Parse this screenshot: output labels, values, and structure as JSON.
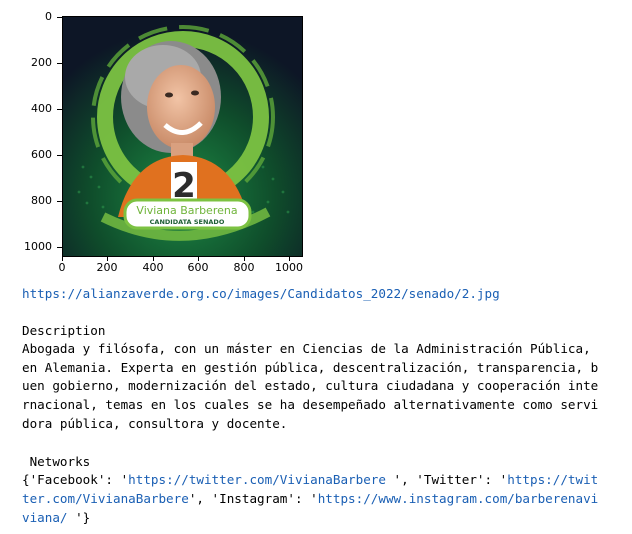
{
  "plot": {
    "yticks": [
      "0",
      "200",
      "400",
      "600",
      "800",
      "1000"
    ],
    "xticks": [
      "0",
      "200",
      "400",
      "600",
      "800",
      "1000"
    ],
    "image": {
      "name_line": "Viviana Barberena",
      "role_line": "CANDIDATA SENADO",
      "number": "2"
    }
  },
  "output": {
    "url": "https://alianzaverde.org.co/images/Candidatos_2022/senado/2.jpg",
    "description_label": "Description",
    "description_lines": [
      "Abogada y filósofa, con un máster en Ciencias de la Administración Pública,",
      "en Alemania. Experta en gestión pública, descentralización, transparencia, b",
      "uen gobierno, modernización del estado, cultura ciudadana y cooperación inte",
      "rnacional, temas en los cuales se ha desempeñado alternativamente como servi",
      "dora pública, consultora y docente."
    ],
    "networks_label": " Networks",
    "networks_lines": [
      {
        "pre": "{'Facebook': '",
        "link": "https://twitter.com/VivianaBarbere ",
        "post": "', 'Twitter': '",
        "link2": "https://twit"
      },
      {
        "pre": "",
        "link": "ter.com/VivianaBarbere",
        "post": "', 'Instagram': '",
        "link2": "https://www.instagram.com/barberenavi"
      },
      {
        "pre": "",
        "link": "viana/ ",
        "post": "'}",
        "link2": ""
      }
    ]
  },
  "colors": {
    "link": "#1a5fb4",
    "green": "#7cc242",
    "dark_green": "#0f4d2b",
    "navy": "#0d1626",
    "orange": "#e0711f"
  }
}
